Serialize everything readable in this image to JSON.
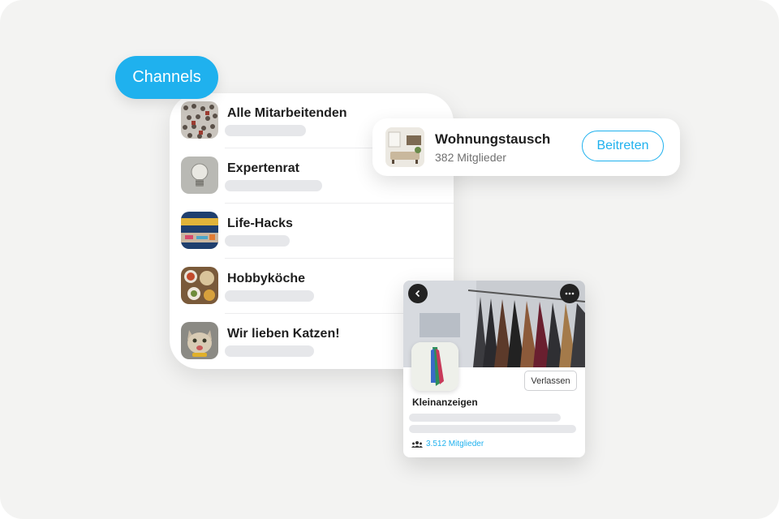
{
  "tag": {
    "label": "Channels"
  },
  "channels": [
    {
      "name": "Alle Mitarbeitenden",
      "thumb_icon": "crowd-photo"
    },
    {
      "name": "Expertenrat",
      "thumb_icon": "light-bulb-photo"
    },
    {
      "name": "Life-Hacks",
      "thumb_icon": "tool-box-photo"
    },
    {
      "name": "Hobbyköche",
      "thumb_icon": "food-spread-photo"
    },
    {
      "name": "Wir lieben Katzen!",
      "thumb_icon": "cat-photo"
    }
  ],
  "join_card": {
    "title": "Wohnungstausch",
    "members": "382 Mitglieder",
    "button": "Beitreten",
    "thumb_icon": "living-room-photo"
  },
  "detail_card": {
    "title": "Kleinanzeigen",
    "leave_button": "Verlassen",
    "members": "3.512 Mitglieder",
    "back_icon": "chevron-left-icon",
    "more_icon": "more-horizontal-icon"
  },
  "colors": {
    "accent": "#1fb1ee",
    "background": "#f3f3f2",
    "skeleton": "#e6e7ea"
  }
}
